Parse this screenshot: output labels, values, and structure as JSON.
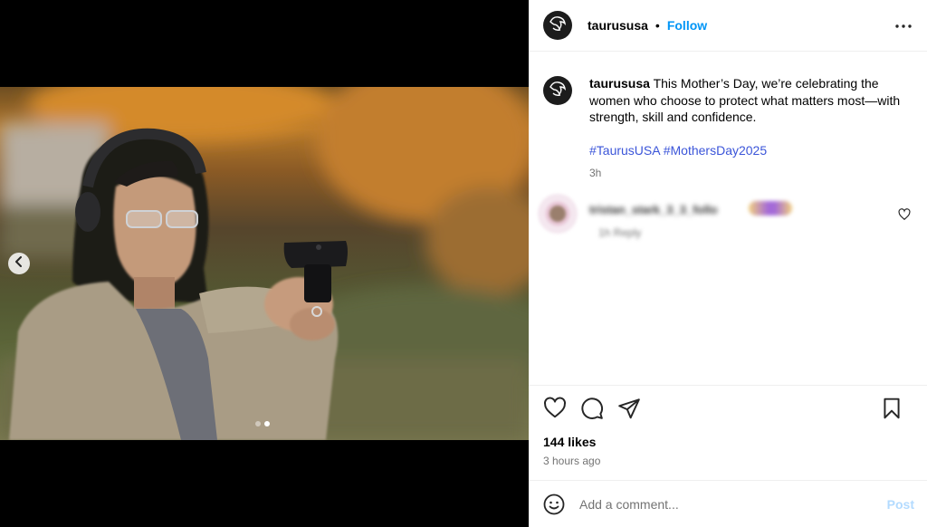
{
  "post": {
    "author": "taurususa",
    "follow_label": "Follow",
    "bullet": "•",
    "caption": "This Mother’s Day, we’re celebrating the women who choose to protect what matters most—with strength, skill and confidence.",
    "hashtags": [
      "#TaurusUSA",
      "#MothersDay2025"
    ],
    "caption_time": "3h",
    "likes": "144 likes",
    "time_ago": "3 hours ago"
  },
  "comments": [
    {
      "user": "tristan_stark_3_3_follo",
      "meta": "1h  Reply"
    }
  ],
  "composer": {
    "placeholder": "Add a comment...",
    "post_label": "Post"
  },
  "carousel": {
    "slide_count": 2,
    "active_slide": 2
  },
  "icons": {
    "avatar": "taurus-logo-icon",
    "more": "more-options-icon",
    "prev": "chevron-left-icon",
    "like": "heart-icon",
    "comment": "comment-icon",
    "share": "share-icon",
    "save": "bookmark-icon",
    "emoji": "emoji-icon"
  },
  "colors": {
    "accent": "#0095f6",
    "hashtag": "#3b55d9",
    "muted": "#737373",
    "post_disabled": "#b3dbff"
  }
}
